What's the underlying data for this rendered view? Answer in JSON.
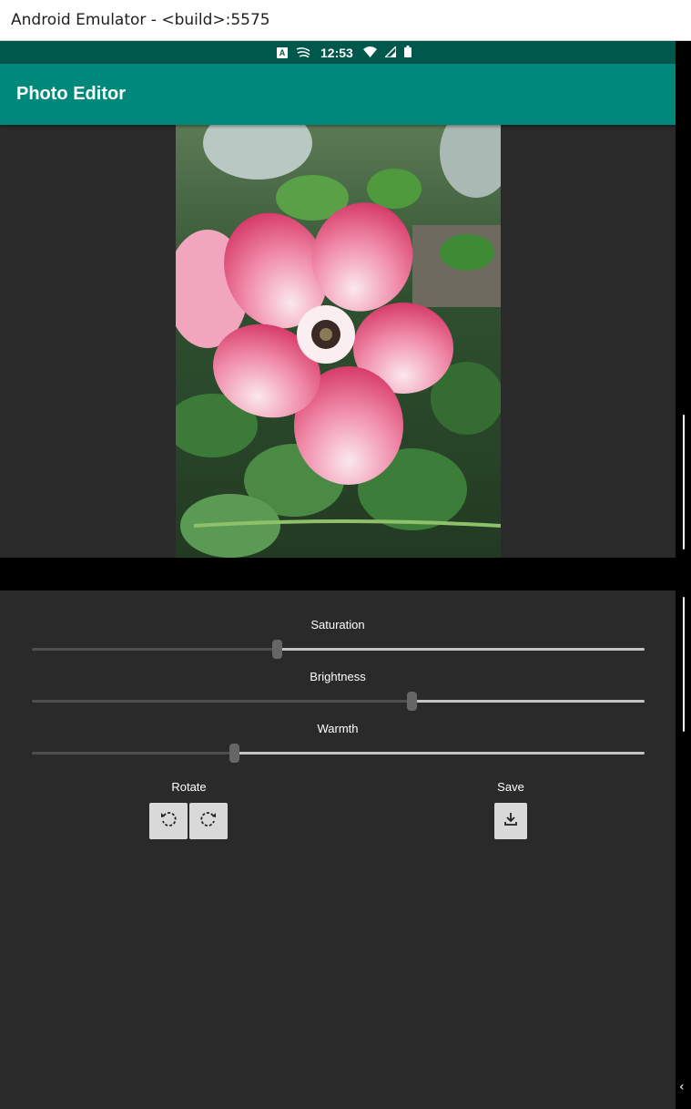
{
  "window": {
    "title": "Android Emulator - <build>:5575"
  },
  "status_bar": {
    "time": "12:53",
    "badge_letter": "A"
  },
  "app_bar": {
    "title": "Photo Editor"
  },
  "sliders": [
    {
      "label": "Saturation",
      "value": 0.4
    },
    {
      "label": "Brightness",
      "value": 0.62
    },
    {
      "label": "Warmth",
      "value": 0.33
    }
  ],
  "rotate": {
    "label": "Rotate",
    "left_icon": "rotate-left-icon",
    "right_icon": "rotate-right-icon"
  },
  "save": {
    "label": "Save",
    "icon": "download-icon"
  },
  "colors": {
    "status_bar": "#00574b",
    "app_bar": "#00897b",
    "background": "#2a2a2a"
  }
}
